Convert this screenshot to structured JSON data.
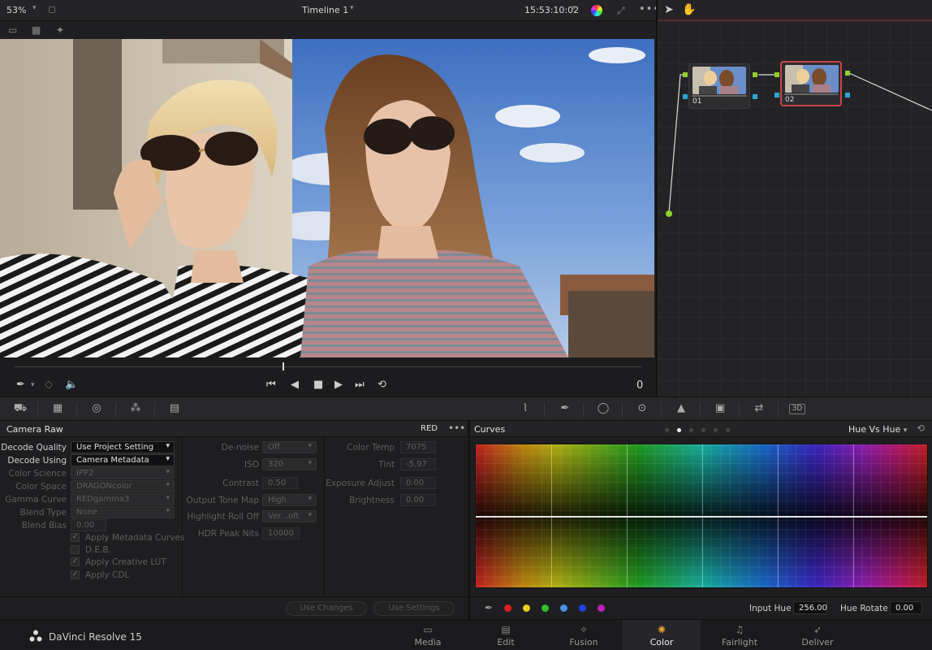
{
  "viewer": {
    "zoom": "53%",
    "timeline_title": "Timeline 1",
    "timecode": "15:53:10:02",
    "frame_number": "0"
  },
  "nodes": [
    {
      "label": "01",
      "selected": false
    },
    {
      "label": "02",
      "selected": true
    }
  ],
  "camera_raw": {
    "title": "Camera Raw",
    "format": "RED",
    "col1": [
      {
        "label": "Decode Quality",
        "value": "Use Project Setting",
        "enabled": true
      },
      {
        "label": "Decode Using",
        "value": "Camera Metadata",
        "enabled": true
      },
      {
        "label": "Color Science",
        "value": "IPP2",
        "enabled": false
      },
      {
        "label": "Color Space",
        "value": "DRAGONcolor",
        "enabled": false
      },
      {
        "label": "Gamma Curve",
        "value": "REDgamma3",
        "enabled": false
      },
      {
        "label": "Blend Type",
        "value": "None",
        "enabled": false
      },
      {
        "label": "Blend Bias",
        "value": "0.00",
        "enabled": false
      }
    ],
    "checkboxes": [
      {
        "label": "Apply Metadata Curves",
        "checked": true
      },
      {
        "label": "D.E.B.",
        "checked": false
      },
      {
        "label": "Apply Creative LUT",
        "checked": true
      },
      {
        "label": "Apply CDL",
        "checked": true
      }
    ],
    "col2": [
      {
        "label": "De-noise",
        "value": "Off",
        "type": "select"
      },
      {
        "label": "ISO",
        "value": "320",
        "type": "select"
      },
      {
        "label": "Contrast",
        "value": "0.50",
        "type": "number"
      },
      {
        "label": "Output Tone Map",
        "value": "High",
        "type": "select"
      },
      {
        "label": "Highlight Roll Off",
        "value": "Ver...oft",
        "type": "select"
      },
      {
        "label": "HDR Peak Nits",
        "value": "10000",
        "type": "number"
      }
    ],
    "col3": [
      {
        "label": "Color Temp",
        "value": "7075"
      },
      {
        "label": "Tint",
        "value": "-5.97"
      },
      {
        "label": "Exposure Adjust",
        "value": "0.00"
      },
      {
        "label": "Brightness",
        "value": "0.00"
      }
    ],
    "use_changes_label": "Use Changes",
    "use_settings_label": "Use Settings"
  },
  "curves": {
    "title": "Curves",
    "mode": "Hue Vs Hue",
    "input_hue_label": "Input Hue",
    "input_hue_value": "256.00",
    "hue_rotate_label": "Hue Rotate",
    "hue_rotate_value": "0.00",
    "swatch_colors": [
      "#e02020",
      "#e0d020",
      "#30c030",
      "#4a90e0",
      "#2040e0",
      "#c020c0"
    ]
  },
  "app": {
    "name": "DaVinci Resolve 15"
  },
  "pages": [
    {
      "label": "Media",
      "icon": "media-icon",
      "active": false
    },
    {
      "label": "Edit",
      "icon": "edit-icon",
      "active": false
    },
    {
      "label": "Fusion",
      "icon": "fusion-icon",
      "active": false
    },
    {
      "label": "Color",
      "icon": "color-icon",
      "active": true
    },
    {
      "label": "Fairlight",
      "icon": "fairlight-icon",
      "active": false
    },
    {
      "label": "Deliver",
      "icon": "deliver-icon",
      "active": false
    }
  ]
}
